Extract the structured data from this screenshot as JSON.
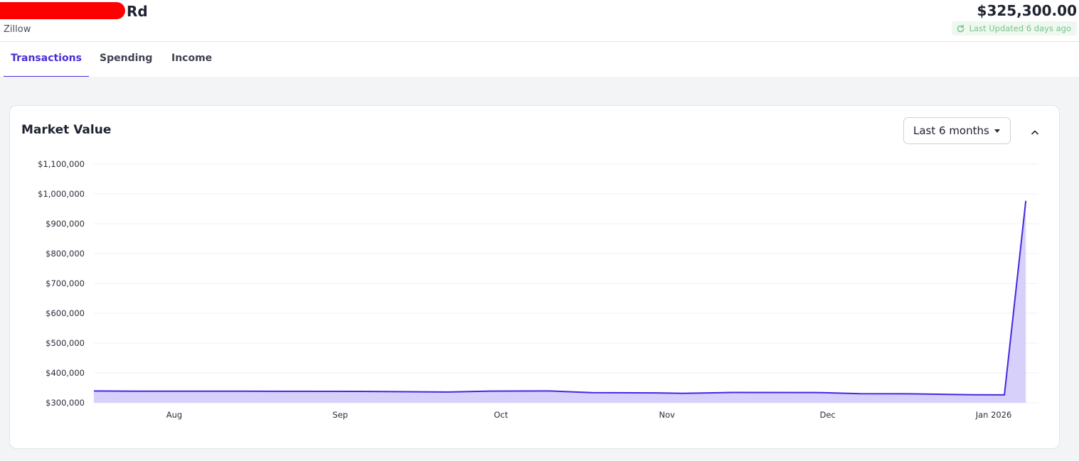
{
  "header": {
    "account_name": "Rd",
    "institution": "Zillow",
    "balance": "$325,300.00",
    "last_updated": "Last Updated 6 days ago",
    "updated_icon": "refresh-icon",
    "updated_color": "#79c38a"
  },
  "tabs": [
    {
      "label": "Transactions",
      "active": true
    },
    {
      "label": "Spending",
      "active": false
    },
    {
      "label": "Income",
      "active": false
    }
  ],
  "card": {
    "title": "Market Value",
    "range_selected": "Last 6 months",
    "collapse_icon": "chevron-up-icon"
  },
  "colors": {
    "accent": "#4a2bd9",
    "line": "#4527e0",
    "area_fill": "#d7d0fb"
  },
  "chart_data": {
    "type": "area",
    "title": "Market Value",
    "xlabel": "",
    "ylabel": "",
    "ylim": [
      300000,
      1100000
    ],
    "y_ticks": [
      1100000,
      1000000,
      900000,
      800000,
      700000,
      600000,
      500000,
      400000,
      300000
    ],
    "y_tick_labels": [
      "$1,100,000",
      "$1,000,000",
      "$900,000",
      "$800,000",
      "$700,000",
      "$600,000",
      "$500,000",
      "$400,000",
      "$300,000"
    ],
    "x_ticks": [
      "2025-08-01",
      "2025-09-01",
      "2025-10-01",
      "2025-11-01",
      "2025-12-01",
      "2026-01-01"
    ],
    "x_tick_labels": [
      "Aug",
      "Sep",
      "Oct",
      "Nov",
      "Dec",
      "Jan 2026"
    ],
    "grid": true,
    "legend": "none",
    "series": [
      {
        "points": [
          {
            "x": "2025-07-17",
            "y": 339500
          },
          {
            "x": "2025-07-25",
            "y": 338500
          },
          {
            "x": "2025-08-15",
            "y": 338500
          },
          {
            "x": "2025-09-05",
            "y": 338000
          },
          {
            "x": "2025-09-21",
            "y": 336000
          },
          {
            "x": "2025-09-29",
            "y": 339000
          },
          {
            "x": "2025-10-10",
            "y": 339500
          },
          {
            "x": "2025-10-18",
            "y": 334000
          },
          {
            "x": "2025-10-30",
            "y": 333000
          },
          {
            "x": "2025-11-04",
            "y": 331500
          },
          {
            "x": "2025-11-13",
            "y": 334500
          },
          {
            "x": "2025-11-30",
            "y": 334000
          },
          {
            "x": "2025-12-07",
            "y": 330500
          },
          {
            "x": "2025-12-16",
            "y": 330000
          },
          {
            "x": "2025-12-28",
            "y": 327000
          },
          {
            "x": "2026-01-03",
            "y": 326500
          },
          {
            "x": "2026-01-07",
            "y": 977000
          }
        ]
      }
    ]
  }
}
